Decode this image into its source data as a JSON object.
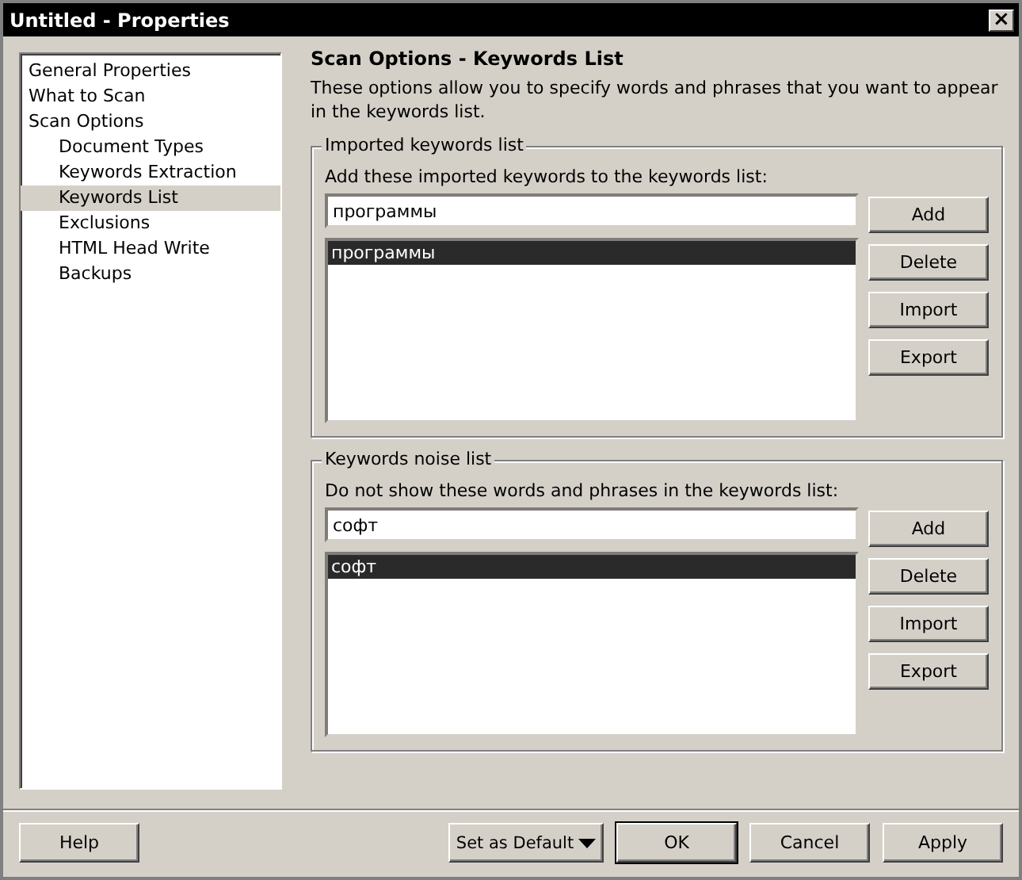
{
  "window": {
    "title": "Untitled - Properties",
    "close": "×"
  },
  "sidebar": {
    "items": [
      {
        "label": "General Properties",
        "selected": false
      },
      {
        "label": "What to Scan",
        "selected": false
      },
      {
        "label": "Scan Options",
        "selected": false,
        "children": [
          {
            "label": "Document Types",
            "selected": false
          },
          {
            "label": "Keywords Extraction",
            "selected": false
          },
          {
            "label": "Keywords List",
            "selected": true
          },
          {
            "label": "Exclusions",
            "selected": false
          },
          {
            "label": "HTML Head Write",
            "selected": false
          },
          {
            "label": "Backups",
            "selected": false
          }
        ]
      }
    ]
  },
  "page": {
    "heading": "Scan Options - Keywords List",
    "description": "These options allow you to specify words and phrases that you want to appear in the keywords list."
  },
  "groups": [
    {
      "title": "Imported keywords list",
      "prompt": "Add these imported keywords to the keywords list:",
      "value": "программы",
      "items": [
        {
          "label": "программы",
          "selected": true
        }
      ],
      "buttons": [
        "Add",
        "Delete",
        "Import",
        "Export"
      ]
    },
    {
      "title": "Keywords noise list",
      "prompt": "Do not show these words and phrases in the keywords list:",
      "value": "софт",
      "items": [
        {
          "label": "софт",
          "selected": true
        }
      ],
      "buttons": [
        "Add",
        "Delete",
        "Import",
        "Export"
      ]
    }
  ],
  "footer": {
    "help": "Help",
    "buttons": [
      {
        "label": "Set as Default",
        "kind": "dropdown",
        "default": false
      },
      {
        "label": "OK",
        "kind": "plain",
        "default": true
      },
      {
        "label": "Cancel",
        "kind": "plain",
        "default": false
      },
      {
        "label": "Apply",
        "kind": "plain",
        "default": false
      }
    ]
  }
}
